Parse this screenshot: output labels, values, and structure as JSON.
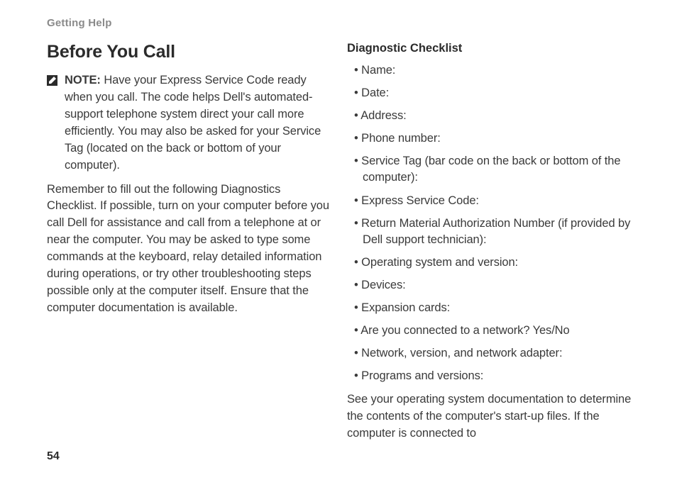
{
  "header": "Getting Help",
  "title": "Before You Call",
  "note": {
    "label": "NOTE:",
    "text": " Have your Express Service Code ready when you call. The code helps Dell's automated-support telephone system direct your call more efficiently. You may also be asked for your Service Tag (located on the back or bottom of your computer)."
  },
  "body": "Remember to fill out the following Diagnostics Checklist. If possible, turn on your computer before you call Dell for assistance and call from a telephone at or near the computer. You may be asked to type some commands at the keyboard, relay detailed information during operations, or try other troubleshooting steps possible only at the computer itself. Ensure that the computer documentation is available.",
  "checklist": {
    "title": "Diagnostic Checklist",
    "items": [
      "Name:",
      "Date:",
      "Address:",
      "Phone number:",
      "Service Tag (bar code on the back or bottom of the computer):",
      "Express Service Code:",
      "Return Material Authorization Number (if provided by Dell support technician):",
      "Operating system and version:",
      "Devices:",
      "Expansion cards:",
      "Are you connected to a network? Yes/No",
      "Network, version, and network adapter:",
      "Programs and versions:"
    ]
  },
  "closing": "See your operating system documentation to determine the contents of the computer's start-up files. If the computer is connected to",
  "page_number": "54"
}
